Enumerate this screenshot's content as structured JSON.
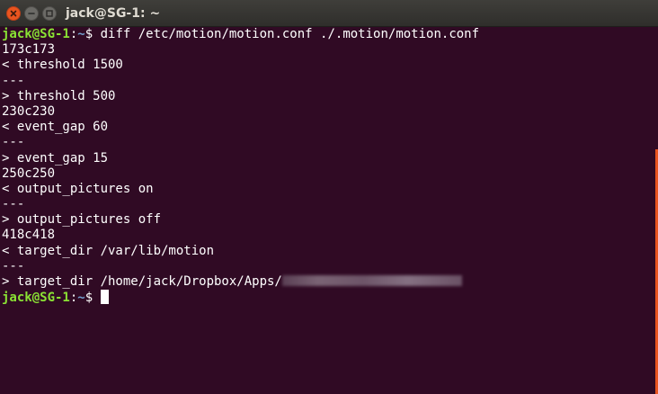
{
  "window": {
    "title": "jack@SG-1: ~"
  },
  "prompt": {
    "user_host": "jack@SG-1",
    "separator": ":",
    "path": "~",
    "symbol": "$ "
  },
  "terminal": {
    "command": "diff /etc/motion/motion.conf ./.motion/motion.conf",
    "output": [
      "173c173",
      "< threshold 1500",
      "---",
      "> threshold 500",
      "230c230",
      "< event_gap 60",
      "---",
      "> event_gap 15",
      "250c250",
      "< output_pictures on",
      "---",
      "> output_pictures off",
      "418c418",
      "< target_dir /var/lib/motion",
      "---"
    ],
    "last_output_prefix": "> target_dir /home/jack/Dropbox/Apps/"
  },
  "colors": {
    "background": "#300a24",
    "prompt_user": "#8ae234",
    "prompt_path": "#729fcf",
    "text": "#ffffff",
    "scrollbar": "#e95420",
    "close_button": "#e9541f"
  }
}
